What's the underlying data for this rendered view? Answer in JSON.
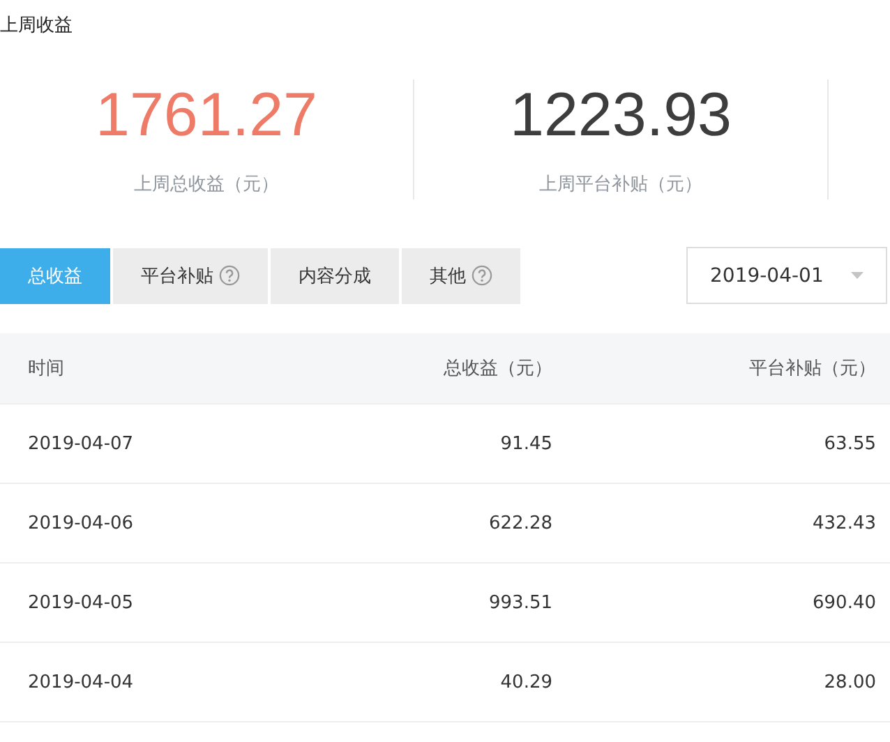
{
  "section_title": "上周收益",
  "stats": [
    {
      "value": "1761.27",
      "label": "上周总收益（元）",
      "kind": "highlight"
    },
    {
      "value": "1223.93",
      "label": "上周平台补贴（元）",
      "kind": "plain"
    }
  ],
  "tabs": [
    {
      "label": "总收益",
      "selected": true,
      "help": false
    },
    {
      "label": "平台补贴",
      "selected": false,
      "help": true
    },
    {
      "label": "内容分成",
      "selected": false,
      "help": false
    },
    {
      "label": "其他",
      "selected": false,
      "help": true
    }
  ],
  "date_picker": {
    "value": "2019-04-01"
  },
  "table": {
    "columns": [
      "时间",
      "总收益（元）",
      "平台补贴（元）"
    ],
    "rows": [
      [
        "2019-04-07",
        "91.45",
        "63.55"
      ],
      [
        "2019-04-06",
        "622.28",
        "432.43"
      ],
      [
        "2019-04-05",
        "993.51",
        "690.40"
      ],
      [
        "2019-04-04",
        "40.29",
        "28.00"
      ]
    ]
  }
}
